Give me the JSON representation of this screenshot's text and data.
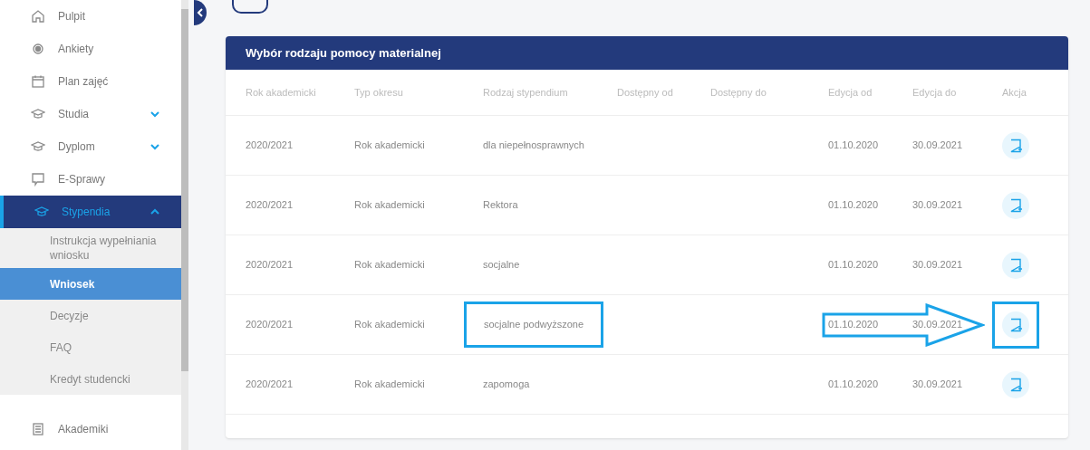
{
  "sidebar": {
    "items": [
      {
        "label": "Pulpit",
        "selected": false
      },
      {
        "label": "Ankiety",
        "selected": false
      },
      {
        "label": "Plan zajęć",
        "selected": false
      },
      {
        "label": "Studia",
        "selected": false,
        "expanded": false
      },
      {
        "label": "Dyplom",
        "selected": false,
        "expanded": false
      },
      {
        "label": "E-Sprawy",
        "selected": false
      },
      {
        "label": "Stypendia",
        "selected": true,
        "expanded": true,
        "children": [
          {
            "label": "Instrukcja wypełniania wniosku",
            "selected": false
          },
          {
            "label": "Wniosek",
            "selected": true
          },
          {
            "label": "Decyzje",
            "selected": false
          },
          {
            "label": "FAQ",
            "selected": false
          },
          {
            "label": "Kredyt studencki",
            "selected": false
          }
        ]
      },
      {
        "label": "Akademiki",
        "selected": false
      }
    ]
  },
  "card": {
    "title": "Wybór rodzaju pomocy materialnej",
    "columns": [
      "Rok akademicki",
      "Typ okresu",
      "Rodzaj stypendium",
      "Dostępny od",
      "Dostępny do",
      "Edycja od",
      "Edycja do",
      "Akcja"
    ],
    "rows": [
      {
        "year": "2020/2021",
        "period": "Rok akademicki",
        "type": "dla niepełnosprawnych",
        "edit_from": "01.10.2020",
        "edit_to": "30.09.2021",
        "annotated": false
      },
      {
        "year": "2020/2021",
        "period": "Rok akademicki",
        "type": "Rektora",
        "edit_from": "01.10.2020",
        "edit_to": "30.09.2021",
        "annotated": false
      },
      {
        "year": "2020/2021",
        "period": "Rok akademicki",
        "type": "socjalne",
        "edit_from": "01.10.2020",
        "edit_to": "30.09.2021",
        "annotated": false
      },
      {
        "year": "2020/2021",
        "period": "Rok akademicki",
        "type": "socjalne podwyższone",
        "edit_from": "01.10.2020",
        "edit_to": "30.09.2021",
        "annotated": true
      },
      {
        "year": "2020/2021",
        "period": "Rok akademicki",
        "type": "zapomoga",
        "edit_from": "01.10.2020",
        "edit_to": "30.09.2021",
        "annotated": false
      }
    ]
  }
}
